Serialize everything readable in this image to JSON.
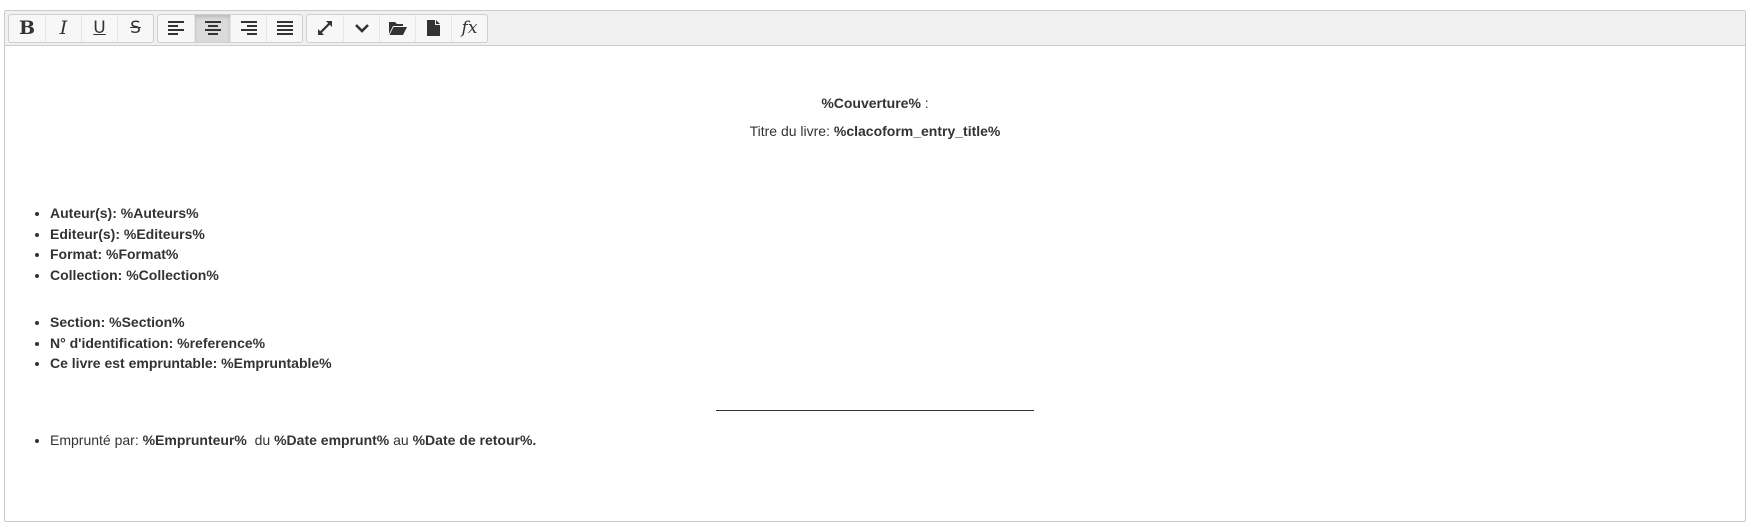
{
  "toolbar": {
    "groups": [
      [
        {
          "name": "bold-button",
          "icon": "bold-icon",
          "glyph": "B"
        },
        {
          "name": "italic-button",
          "icon": "italic-icon",
          "glyph": "I"
        },
        {
          "name": "underline-button",
          "icon": "underline-icon",
          "glyph": "U"
        },
        {
          "name": "strikethrough-button",
          "icon": "strikethrough-icon",
          "glyph": "S"
        }
      ],
      [
        {
          "name": "align-left-button",
          "icon": "align-left-icon"
        },
        {
          "name": "align-center-button",
          "icon": "align-center-icon",
          "active": true
        },
        {
          "name": "align-right-button",
          "icon": "align-right-icon"
        },
        {
          "name": "align-justify-button",
          "icon": "align-justify-icon"
        }
      ],
      [
        {
          "name": "fullscreen-button",
          "icon": "expand-icon"
        },
        {
          "name": "more-button",
          "icon": "chevron-down-icon"
        },
        {
          "name": "open-folder-button",
          "icon": "folder-open-icon"
        },
        {
          "name": "new-file-button",
          "icon": "file-icon"
        },
        {
          "name": "formula-button",
          "icon": "function-icon",
          "glyph": "fx"
        }
      ]
    ]
  },
  "content": {
    "cover": {
      "bold": "%Couverture%",
      "suffix": " :"
    },
    "title": {
      "label": "Titre du livre: ",
      "value": "%clacoform_entry_title%"
    },
    "list1": [
      {
        "label": "Auteur(s): ",
        "value": "%Auteurs%"
      },
      {
        "label": "Editeur(s): ",
        "value": "%Editeurs%"
      },
      {
        "label": "Format: ",
        "value": "%Format%"
      },
      {
        "label": "Collection: ",
        "value": "%Collection%"
      }
    ],
    "list2": [
      {
        "label": "Section: ",
        "value": "%Section%"
      },
      {
        "label": "N° d'identification: ",
        "value": "%reference%"
      },
      {
        "label": "Ce livre est empruntable: ",
        "value": "%Empruntable%"
      }
    ],
    "borrow": {
      "prefix": "Emprunté par: ",
      "borrower": "%Emprunteur%",
      "from_word": "  du ",
      "date_from": "%Date emprunt%",
      "to_word": " au ",
      "date_to": "%Date de retour%."
    }
  }
}
